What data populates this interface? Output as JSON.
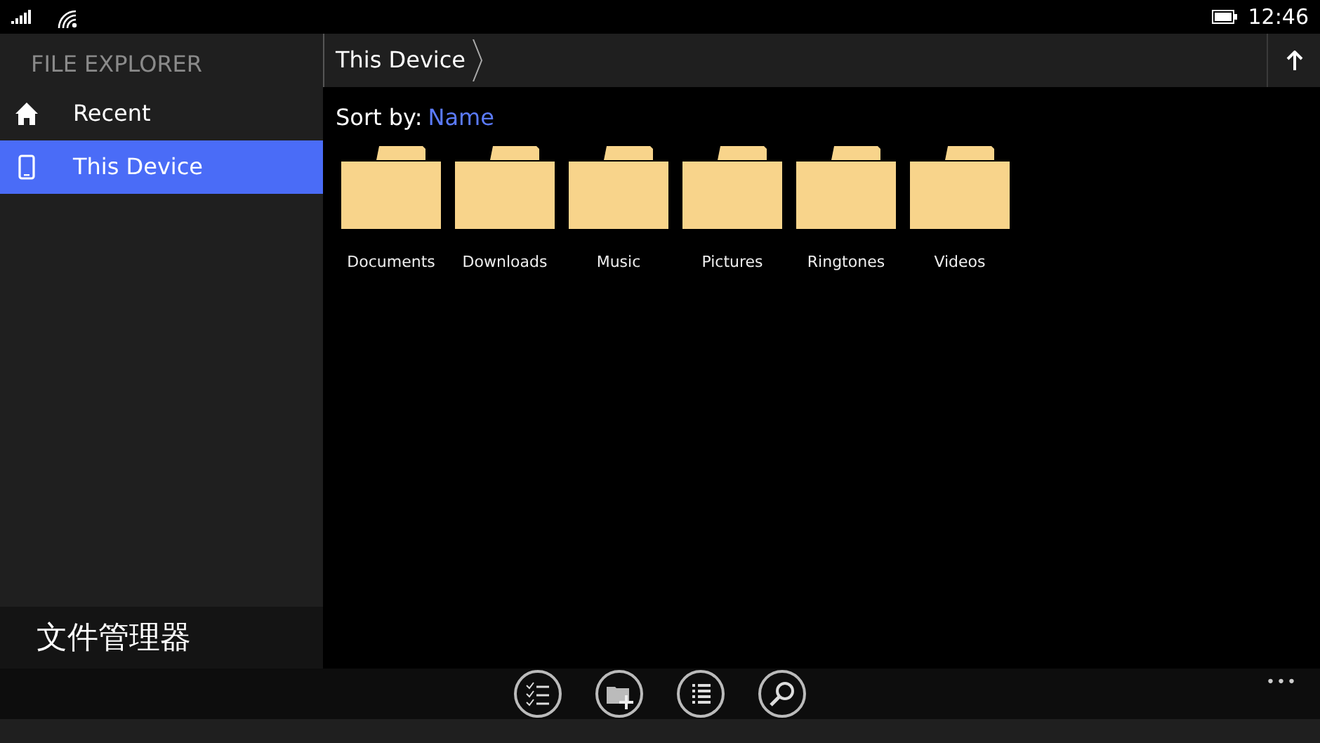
{
  "status_bar": {
    "time": "12:46"
  },
  "sidebar": {
    "title": "FILE EXPLORER",
    "items": [
      {
        "label": "Recent",
        "kind": "home",
        "selected": false
      },
      {
        "label": "This Device",
        "kind": "phone",
        "selected": true
      }
    ],
    "caption": "文件管理器"
  },
  "breadcrumb": {
    "label": "This Device"
  },
  "sort": {
    "label": "Sort by:",
    "value": "Name"
  },
  "folders": [
    {
      "name": "Documents"
    },
    {
      "name": "Downloads"
    },
    {
      "name": "Music"
    },
    {
      "name": "Pictures"
    },
    {
      "name": "Ringtones"
    },
    {
      "name": "Videos"
    }
  ],
  "app_bar": {
    "buttons": [
      {
        "kind": "select"
      },
      {
        "kind": "new-folder"
      },
      {
        "kind": "list"
      },
      {
        "kind": "search"
      }
    ],
    "more": "•••"
  }
}
